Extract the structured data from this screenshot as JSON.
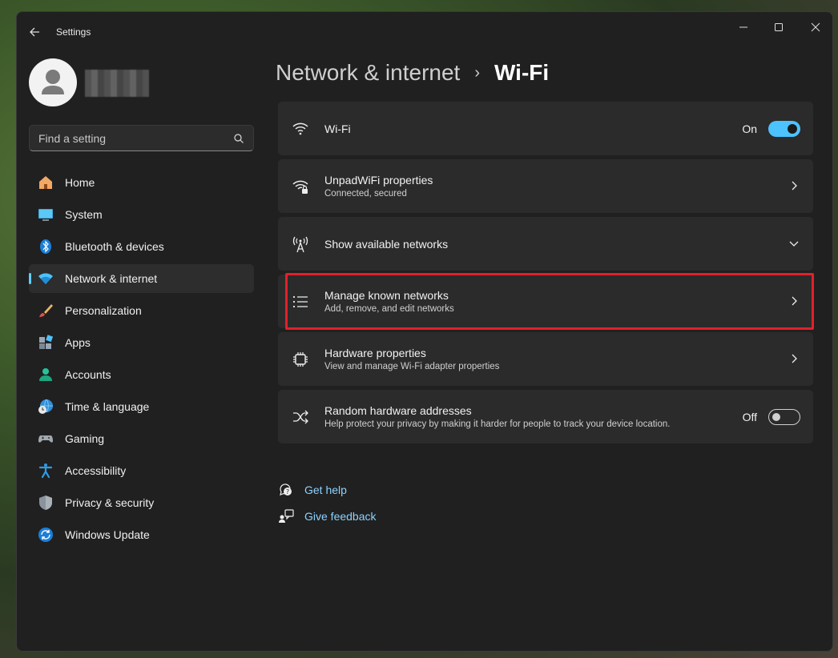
{
  "window": {
    "title": "Settings"
  },
  "search": {
    "placeholder": "Find a setting"
  },
  "sidebar": {
    "items": [
      {
        "label": "Home",
        "icon": "home-icon"
      },
      {
        "label": "System",
        "icon": "system-icon"
      },
      {
        "label": "Bluetooth & devices",
        "icon": "bluetooth-icon"
      },
      {
        "label": "Network & internet",
        "icon": "network-icon",
        "active": true
      },
      {
        "label": "Personalization",
        "icon": "brush-icon"
      },
      {
        "label": "Apps",
        "icon": "apps-icon"
      },
      {
        "label": "Accounts",
        "icon": "accounts-icon"
      },
      {
        "label": "Time & language",
        "icon": "globe-clock-icon"
      },
      {
        "label": "Gaming",
        "icon": "gamepad-icon"
      },
      {
        "label": "Accessibility",
        "icon": "accessibility-icon"
      },
      {
        "label": "Privacy & security",
        "icon": "shield-icon"
      },
      {
        "label": "Windows Update",
        "icon": "update-icon"
      }
    ]
  },
  "breadcrumb": {
    "parent": "Network & internet",
    "separator": "›",
    "current": "Wi-Fi"
  },
  "cards": {
    "wifi": {
      "title": "Wi-Fi",
      "toggle_label": "On",
      "toggle_state": "on"
    },
    "properties": {
      "title": "UnpadWiFi properties",
      "subtitle": "Connected, secured"
    },
    "available": {
      "title": "Show available networks"
    },
    "manage": {
      "title": "Manage known networks",
      "subtitle": "Add, remove, and edit networks"
    },
    "hardware": {
      "title": "Hardware properties",
      "subtitle": "View and manage Wi-Fi adapter properties"
    },
    "random": {
      "title": "Random hardware addresses",
      "subtitle": "Help protect your privacy by making it harder for people to track your device location.",
      "toggle_label": "Off",
      "toggle_state": "off"
    }
  },
  "links": {
    "help": "Get help",
    "feedback": "Give feedback"
  },
  "colors": {
    "accent": "#4cc2ff",
    "highlight": "#e3202a",
    "link": "#8cd2ff",
    "background": "#202020",
    "card": "#2b2b2b"
  }
}
